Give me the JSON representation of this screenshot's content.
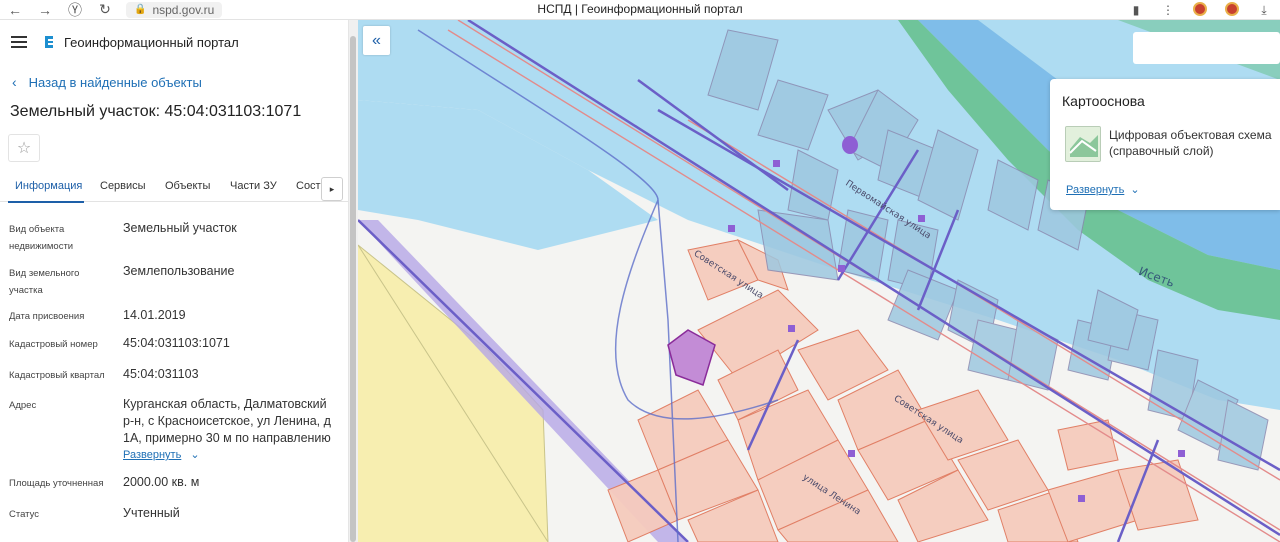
{
  "browser": {
    "url": "nspd.gov.ru",
    "title": "НСПД | Геоинформационный портал"
  },
  "app": {
    "title": "Геоинформационный портал",
    "back_label": "Назад в найденные объекты",
    "object_title": "Земельный участок: 45:04:031103:1071"
  },
  "tabs": [
    "Информация",
    "Сервисы",
    "Объекты",
    "Части ЗУ",
    "Соста"
  ],
  "fields": [
    {
      "label": "Вид объекта недвижимости",
      "value": "Земельный участок"
    },
    {
      "label": "Вид земельного участка",
      "value": "Землепользование"
    },
    {
      "label": "Дата присвоения",
      "value": "14.01.2019"
    },
    {
      "label": "Кадастровый номер",
      "value": "45:04:031103:1071"
    },
    {
      "label": "Кадастровый квартал",
      "value": "45:04:031103"
    },
    {
      "label": "Адрес",
      "value": "Курганская область, Далматовский р-н, с Красноисетское, ул Ленина, д 1А, примерно 30 м по направлению",
      "expand": "Развернуть"
    },
    {
      "label": "Площадь уточненная",
      "value": "2000.00 кв. м"
    },
    {
      "label": "Статус",
      "value": "Учтенный"
    }
  ],
  "map": {
    "basemap_title": "Картооснова",
    "layer_name": "Цифровая объектовая схема (справочный слой)",
    "expand_label": "Развернуть",
    "labels": {
      "river": "Исеть",
      "street1": "Советская улица",
      "street2": "Советская улица",
      "street3": "Первомайская улица",
      "street4": "улица Ленина"
    },
    "colors": {
      "water": "#a8d8f0",
      "river": "#7fb8ea",
      "green": "#5fb88d",
      "parcel_fill": "#f6cbbd",
      "parcel_stroke": "#e07a5f",
      "selected": "#c38cd6",
      "road": "#6b5fc7",
      "yellow": "#f7eeb0"
    }
  }
}
